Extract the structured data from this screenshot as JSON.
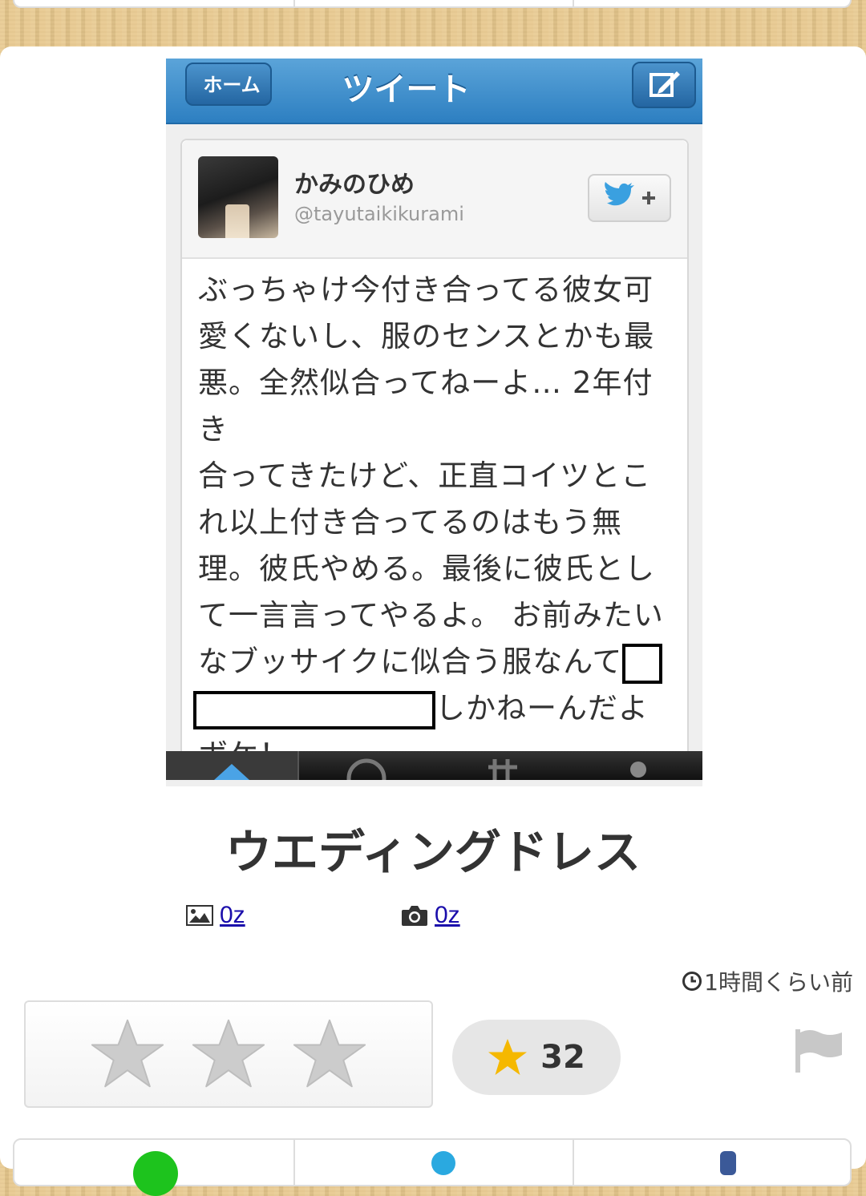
{
  "tweet_screenshot": {
    "back_label": "ホーム",
    "title": "ツイート",
    "user_name": "かみのひめ",
    "user_handle": "@tayutaikikurami",
    "body_lines": [
      "ぶっちゃけ今付き合ってる彼女可",
      "愛くないし、服のセンスとかも最",
      "悪。全然似合ってねーよ… 2年付き",
      "合ってきたけど、正直コイツとこ",
      "れ以上付き合ってるのはもう無",
      "理。彼氏やめる。最後に彼氏とし",
      "て一言言ってやるよ。 お前みたい"
    ],
    "line8": "なブッサイクに似合う服なんて",
    "line9": "しかねーんだよ",
    "line10": "ボケ！"
  },
  "post": {
    "title": "ウエディングドレス",
    "image_count": "0z",
    "photo_count": "0z",
    "time_ago": "1時間くらい前",
    "favorite_count": "32"
  },
  "colors": {
    "twitter_blue": "#2d7fc1",
    "star_gold": "#f5b800",
    "star_gray": "#cccccc",
    "link": "#1a0dab"
  },
  "icons": [
    "image-icon",
    "camera-icon",
    "clock-icon",
    "star-icon",
    "flag-icon",
    "twitter-bird-icon",
    "compose-icon"
  ]
}
